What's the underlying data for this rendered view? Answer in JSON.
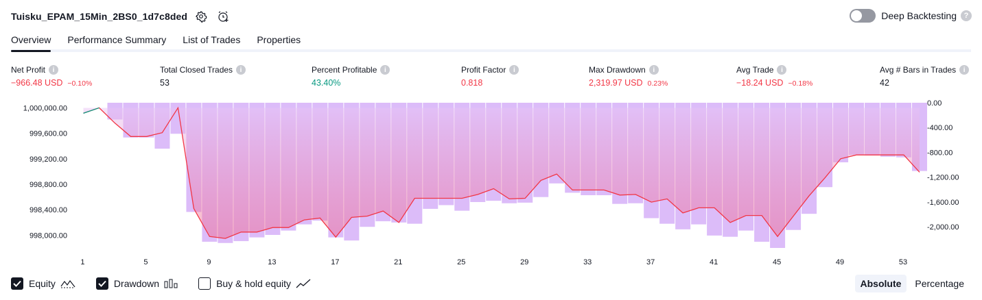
{
  "header": {
    "title": "Tuisku_EPAM_15Min_2BS0_1d7c8ded",
    "deep_backtesting_label": "Deep Backtesting"
  },
  "tabs": [
    {
      "label": "Overview",
      "active": true
    },
    {
      "label": "Performance Summary"
    },
    {
      "label": "List of Trades"
    },
    {
      "label": "Properties"
    }
  ],
  "stats": {
    "net_profit": {
      "label": "Net Profit",
      "value": "−966.48 USD",
      "sub": "−0.10%"
    },
    "total_closed_trades": {
      "label": "Total Closed Trades",
      "value": "53"
    },
    "percent_profitable": {
      "label": "Percent Profitable",
      "value": "43.40%"
    },
    "profit_factor": {
      "label": "Profit Factor",
      "value": "0.818"
    },
    "max_drawdown": {
      "label": "Max Drawdown",
      "value": "2,319.97 USD",
      "sub": "0.23%"
    },
    "avg_trade": {
      "label": "Avg Trade",
      "value": "−18.24 USD",
      "sub": "−0.18%"
    },
    "avg_bars": {
      "label": "Avg # Bars in Trades",
      "value": "42"
    }
  },
  "colors": {
    "negative": "#f23645",
    "positive": "#089981",
    "drawdown_bar": "#d9b7fa",
    "equity_line": "#f23645"
  },
  "chart_data": {
    "type": "area",
    "y_left": {
      "ticks": [
        1000000,
        999600,
        999200,
        998800,
        998400,
        998000
      ],
      "tick_labels": [
        "1,000,000.00",
        "999,600.00",
        "999,200.00",
        "998,800.00",
        "998,400.00",
        "998,000.00"
      ],
      "range": [
        997800,
        1000080
      ]
    },
    "y_right": {
      "ticks": [
        0,
        -400,
        -800,
        -1200,
        -1600,
        -2000
      ],
      "tick_labels": [
        "0.00",
        "-400.00",
        "-800.00",
        "-1,200.00",
        "-1,600.00",
        "-2,000.00"
      ],
      "range": [
        -2340,
        0
      ]
    },
    "x_ticks": [
      1,
      5,
      9,
      13,
      17,
      21,
      25,
      29,
      33,
      37,
      41,
      45,
      49,
      53
    ],
    "x_range": [
      1,
      54
    ],
    "equity": [
      999915,
      1000000,
      999760,
      999550,
      999550,
      999610,
      1000000,
      998420,
      997980,
      997950,
      998050,
      998050,
      998120,
      998120,
      998240,
      998270,
      997970,
      998280,
      998300,
      998380,
      998200,
      998580,
      998580,
      998580,
      998580,
      998640,
      998730,
      998570,
      998580,
      998860,
      998960,
      998710,
      998710,
      998710,
      998630,
      998640,
      998520,
      998570,
      998350,
      998430,
      998430,
      998200,
      998310,
      998310,
      997980,
      998300,
      998620,
      998900,
      999200,
      999260,
      999260,
      999260,
      999260,
      998990
    ],
    "drawdown": [
      0,
      0,
      -270,
      -560,
      -560,
      -740,
      -500,
      -1760,
      -2240,
      -2260,
      -2230,
      -2170,
      -2130,
      -2060,
      -1960,
      -1900,
      -2170,
      -2220,
      -2000,
      -1910,
      -1930,
      -1950,
      -1710,
      -1650,
      -1740,
      -1600,
      -1580,
      -1620,
      -1610,
      -1520,
      -1300,
      -1450,
      -1490,
      -1490,
      -1630,
      -1620,
      -1860,
      -1950,
      -2040,
      -1960,
      -2140,
      -2160,
      -2060,
      -2240,
      -2340,
      -2050,
      -1790,
      -1360,
      -960,
      -840,
      -850,
      -870,
      -880,
      -1100
    ]
  },
  "legend": {
    "equity": {
      "label": "Equity",
      "checked": true
    },
    "drawdown": {
      "label": "Drawdown",
      "checked": true
    },
    "buy_hold": {
      "label": "Buy & hold equity",
      "checked": false
    }
  },
  "mode": {
    "absolute": "Absolute",
    "percentage": "Percentage",
    "active": "Absolute"
  }
}
